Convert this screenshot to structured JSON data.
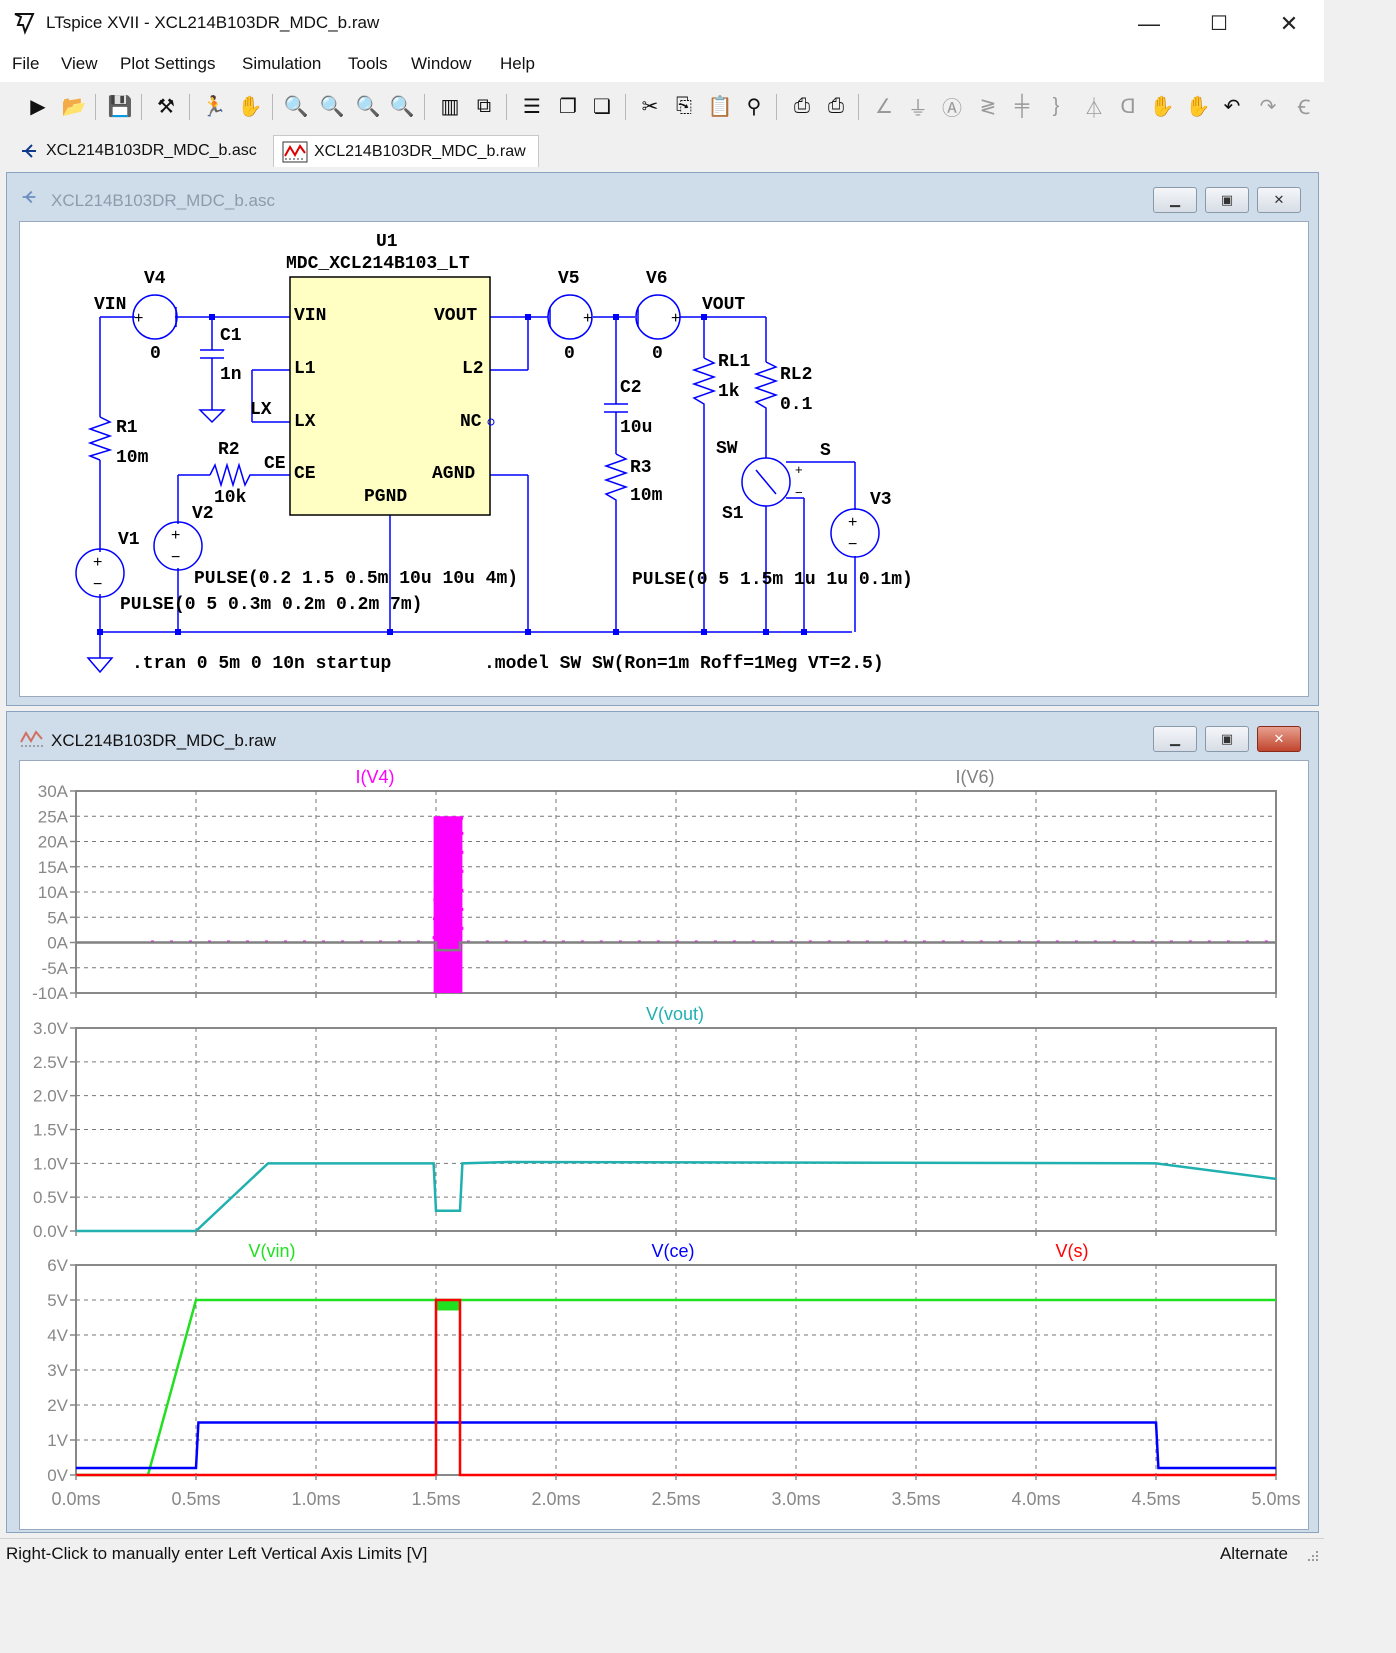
{
  "window": {
    "title": "LTspice XVII - XCL214B103DR_MDC_b.raw",
    "minimize": "—",
    "maximize": "☐",
    "close": "✕"
  },
  "menu": [
    "File",
    "View",
    "Plot Settings",
    "Simulation",
    "Tools",
    "Window",
    "Help"
  ],
  "tabs": [
    {
      "label": "XCL214B103DR_MDC_b.asc",
      "icon": "schematic-icon",
      "active": false
    },
    {
      "label": "XCL214B103DR_MDC_b.raw",
      "icon": "waveform-icon",
      "active": true
    }
  ],
  "schematic_window": {
    "title": "XCL214B103DR_MDC_b.asc",
    "component": {
      "ref": "U1",
      "model": "MDC_XCL214B103_LT",
      "pins_left": [
        "VIN",
        "L1",
        "LX",
        "CE"
      ],
      "pins_right": [
        "VOUT",
        "L2",
        "NC",
        "AGND"
      ],
      "pin_bottom": "PGND"
    },
    "labels": {
      "vin": "VIN",
      "v4": "V4",
      "v4_val": "0",
      "c1": "C1",
      "c1_val": "1n",
      "lx": "LX",
      "r1": "R1",
      "r1_val": "10m",
      "r2": "R2",
      "r2_val": "10k",
      "ce": "CE",
      "v2": "V2",
      "v1": "V1",
      "v2_pulse": "PULSE(0.2 1.5 0.5m 10u 10u 4m)",
      "v1_pulse": "PULSE(0 5 0.3m 0.2m 0.2m 7m)",
      "v5": "V5",
      "v5_val": "0",
      "v6": "V6",
      "v6_val": "0",
      "vout": "VOUT",
      "c2": "C2",
      "c2_val": "10u",
      "r3": "R3",
      "r3_val": "10m",
      "rl1": "RL1",
      "rl1_val": "1k",
      "rl2": "RL2",
      "rl2_val": "0.1",
      "sw": "SW",
      "s": "S",
      "s1": "S1",
      "v3": "V3",
      "v3_pulse": "PULSE(0 5 1.5m 1u 1u 0.1m)",
      "tran": ".tran 0 5m 0 10n startup",
      "model": ".model SW SW(Ron=1m Roff=1Meg VT=2.5)"
    }
  },
  "waveform_window": {
    "title": "XCL214B103DR_MDC_b.raw"
  },
  "chart_data": [
    {
      "type": "line",
      "series": [
        {
          "name": "I(V4)",
          "color": "#ff00ff",
          "x": [
            0.0,
            0.3,
            0.3,
            1.49,
            1.5,
            1.5,
            1.61,
            1.61,
            5.0
          ],
          "y": [
            0,
            0,
            0.2,
            0.2,
            25,
            -10,
            25,
            0.2,
            0.2
          ]
        },
        {
          "name": "I(V6)",
          "color": "#808080",
          "x": [
            0.0,
            1.5,
            1.5,
            1.6,
            1.6,
            5.0
          ],
          "y": [
            0,
            0,
            -1.5,
            -1.5,
            0,
            0
          ]
        }
      ],
      "yticks": [
        "30A",
        "25A",
        "20A",
        "15A",
        "10A",
        "5A",
        "0A",
        "-5A",
        "-10A"
      ],
      "ylim": [
        -10,
        30
      ],
      "xlim": [
        0,
        5
      ],
      "grid": true
    },
    {
      "type": "line",
      "series": [
        {
          "name": "V(vout)",
          "color": "#20b0b0",
          "x": [
            0.0,
            0.5,
            0.8,
            1.49,
            1.5,
            1.6,
            1.61,
            1.8,
            4.5,
            5.0
          ],
          "y": [
            0,
            0,
            1.0,
            1.0,
            0.3,
            0.3,
            1.0,
            1.02,
            1.0,
            0.77
          ]
        }
      ],
      "yticks": [
        "3.0V",
        "2.5V",
        "2.0V",
        "1.5V",
        "1.0V",
        "0.5V",
        "0.0V"
      ],
      "ylim": [
        0,
        3
      ],
      "xlim": [
        0,
        5
      ],
      "grid": true
    },
    {
      "type": "line",
      "series": [
        {
          "name": "V(vin)",
          "color": "#20e020",
          "x": [
            0.0,
            0.3,
            0.5,
            5.0
          ],
          "y": [
            0,
            0,
            5,
            5
          ]
        },
        {
          "name": "V(ce)",
          "color": "#0000ff",
          "x": [
            0.0,
            0.5,
            0.51,
            4.5,
            4.51,
            5.0
          ],
          "y": [
            0.2,
            0.2,
            1.5,
            1.5,
            0.2,
            0.2
          ]
        },
        {
          "name": "V(s)",
          "color": "#ff0000",
          "x": [
            0.0,
            1.5,
            1.5,
            1.6,
            1.6,
            5.0
          ],
          "y": [
            0,
            0,
            5,
            5,
            0,
            0
          ]
        }
      ],
      "yticks": [
        "6V",
        "5V",
        "4V",
        "3V",
        "2V",
        "1V",
        "0V"
      ],
      "ylim": [
        0,
        6
      ],
      "xlim": [
        0,
        5
      ],
      "grid": true,
      "xticks": [
        "0.0ms",
        "0.5ms",
        "1.0ms",
        "1.5ms",
        "2.0ms",
        "2.5ms",
        "3.0ms",
        "3.5ms",
        "4.0ms",
        "4.5ms",
        "5.0ms"
      ]
    }
  ],
  "status": {
    "left": "Right-Click to manually enter Left Vertical Axis Limits [V]",
    "right": "Alternate"
  }
}
